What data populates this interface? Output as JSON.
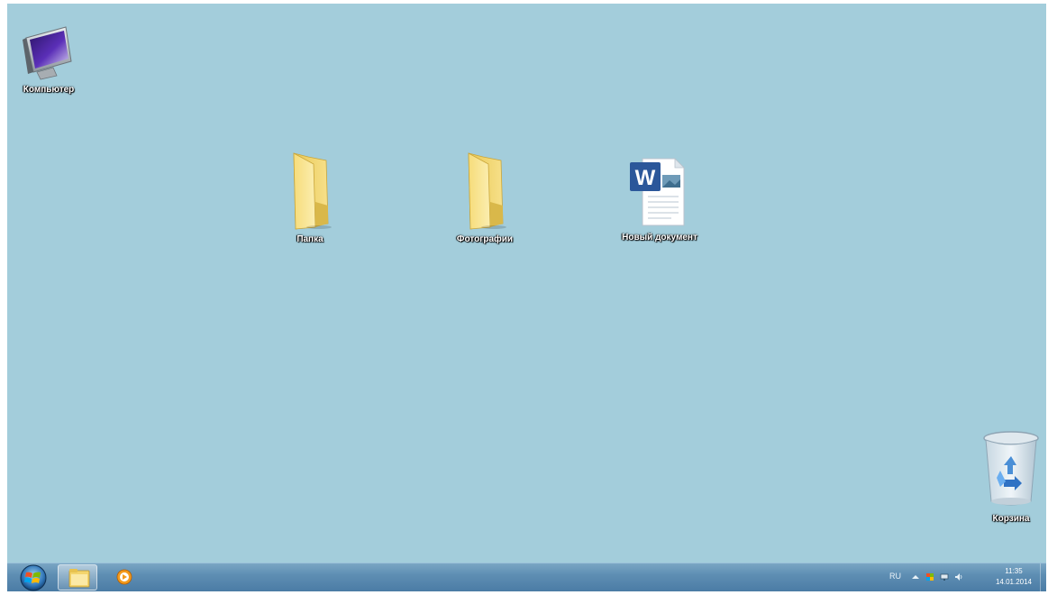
{
  "desktop": {
    "background_color": "#a3cddb",
    "icons": [
      {
        "name": "computer",
        "label": "Компьютер",
        "icon": "computer-icon"
      },
      {
        "name": "folder-1",
        "label": "Папка",
        "icon": "folder-icon"
      },
      {
        "name": "folder-2",
        "label": "Фотографии",
        "icon": "folder-icon"
      },
      {
        "name": "word-doc",
        "label": "Новый документ",
        "icon": "word-document-icon"
      },
      {
        "name": "recycle-bin",
        "label": "Корзина",
        "icon": "recycle-bin-icon"
      }
    ]
  },
  "taskbar": {
    "start_icon": "windows-start-icon",
    "pinned": [
      {
        "name": "explorer",
        "icon": "folder-explorer-icon"
      },
      {
        "name": "media-player",
        "icon": "media-player-icon"
      }
    ],
    "tray": {
      "language": "RU",
      "icons": [
        "chevron-up-icon",
        "flag-icon",
        "network-icon",
        "volume-icon"
      ]
    },
    "clock": {
      "time": "11:35",
      "date": "14.01.2014"
    }
  }
}
